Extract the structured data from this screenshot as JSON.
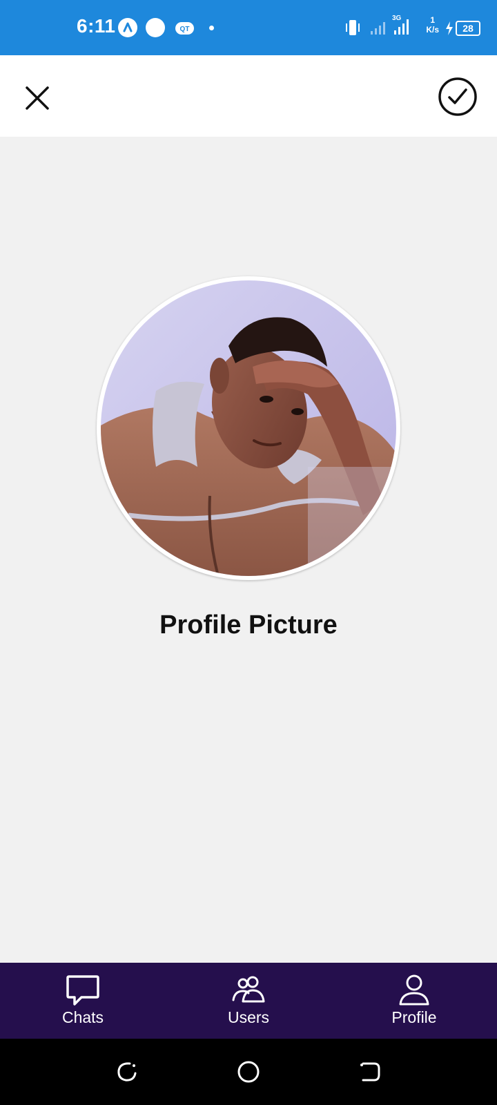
{
  "status_bar": {
    "time": "6:11",
    "network_speed_value": "1",
    "network_speed_unit": "K/s",
    "battery_level": "28",
    "network_type": "3G",
    "color": "#1e88dc"
  },
  "topbar": {
    "close_icon": "close-icon",
    "confirm_icon": "check-circle-icon"
  },
  "main": {
    "title": "Profile Picture"
  },
  "bottom_nav": {
    "color": "#250f4d",
    "items": [
      {
        "label": "Chats",
        "icon": "chat-bubble-icon"
      },
      {
        "label": "Users",
        "icon": "users-icon"
      },
      {
        "label": "Profile",
        "icon": "person-icon"
      }
    ]
  },
  "system_nav": {
    "items": [
      "recents-icon",
      "home-icon",
      "back-icon"
    ]
  }
}
